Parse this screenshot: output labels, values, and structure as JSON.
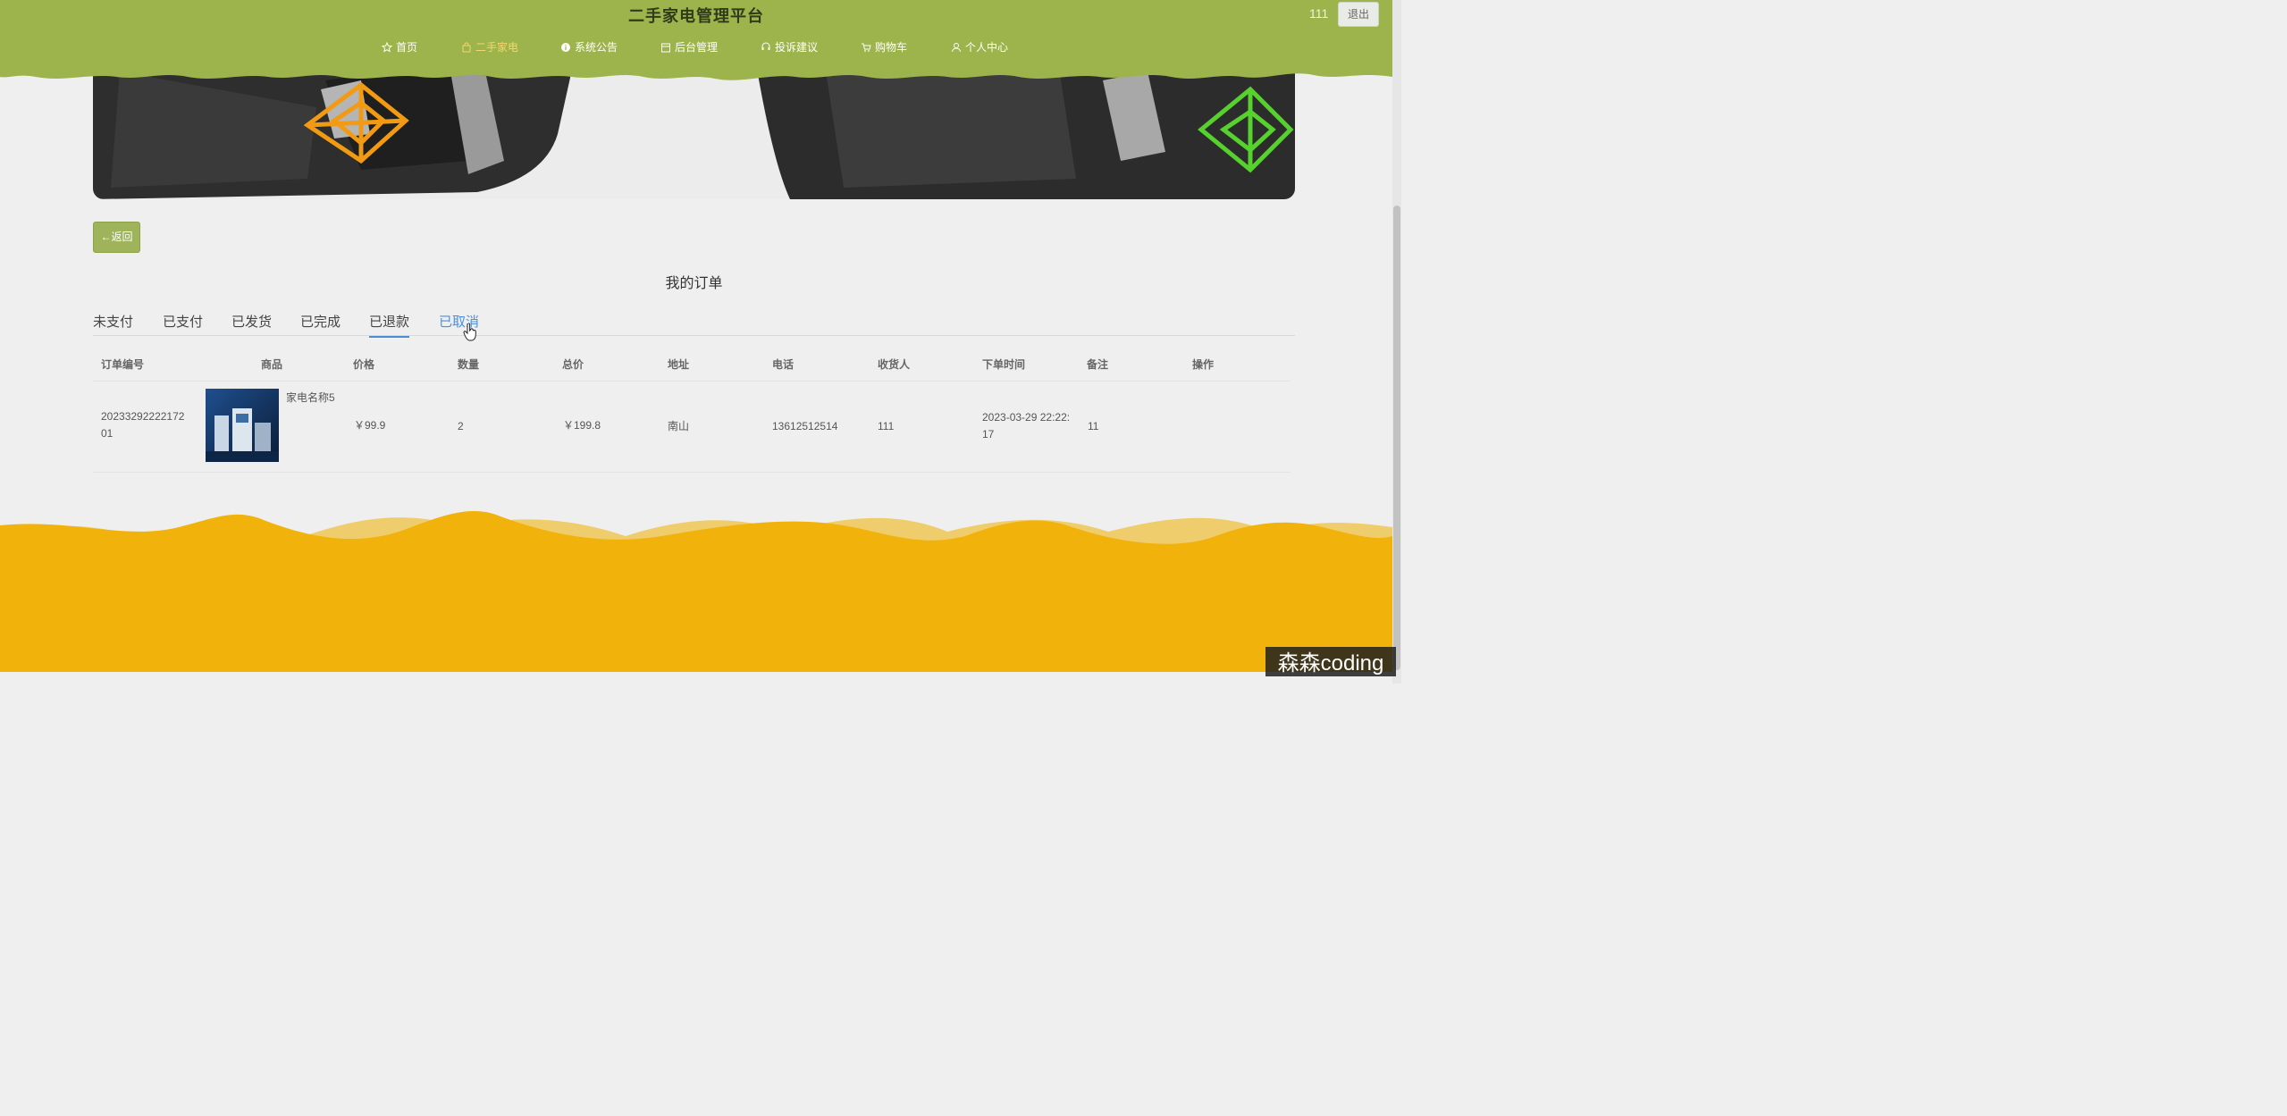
{
  "header": {
    "title": "二手家电管理平台",
    "username": "111",
    "logout_label": "退出",
    "bg_color": "#9db34b",
    "active_color": "#f5d76e"
  },
  "nav": [
    {
      "label": "首页",
      "icon": "star-icon"
    },
    {
      "label": "二手家电",
      "icon": "bag-icon",
      "active": true
    },
    {
      "label": "系统公告",
      "icon": "info-icon"
    },
    {
      "label": "后台管理",
      "icon": "admin-icon"
    },
    {
      "label": "投诉建议",
      "icon": "feedback-icon"
    },
    {
      "label": "购物车",
      "icon": "cart-icon"
    },
    {
      "label": "个人中心",
      "icon": "user-icon"
    }
  ],
  "back_button": {
    "label": "←返回"
  },
  "page_title": "我的订单",
  "tabs": [
    {
      "label": "未支付"
    },
    {
      "label": "已支付"
    },
    {
      "label": "已发货"
    },
    {
      "label": "已完成"
    },
    {
      "label": "已退款",
      "underlined": true
    },
    {
      "label": "已取消",
      "hovered": true
    }
  ],
  "table": {
    "headers": [
      "订单编号",
      "商品",
      "价格",
      "数量",
      "总价",
      "地址",
      "电话",
      "收货人",
      "下单时间",
      "备注",
      "操作"
    ],
    "rows": [
      {
        "order_no_line1": "20233292222172",
        "order_no_line2": "01",
        "product_name": "家电名称5",
        "price": "￥99.9",
        "quantity": "2",
        "total": "￥199.8",
        "address": "南山",
        "phone": "13612512514",
        "receiver": "111",
        "time_line1": "2023-03-29 22:22:",
        "time_line2": "17",
        "remark": "11"
      }
    ]
  },
  "watermark": "森森coding",
  "footer_color": "#f2b20c"
}
